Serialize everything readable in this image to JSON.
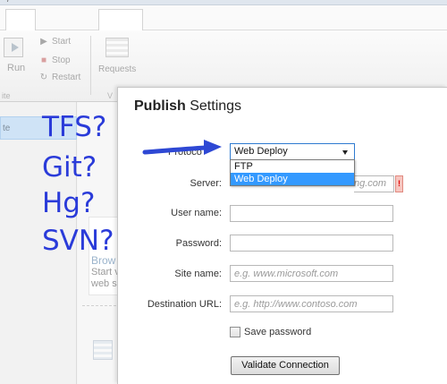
{
  "app": {
    "title_fragment": "/",
    "ribbon": {
      "run_label": "Run",
      "start_label": "Start",
      "stop_label": "Stop",
      "restart_label": "Restart",
      "requests_label": "Requests",
      "group_fragment_left": "ite",
      "group_fragment_right": "V"
    },
    "left_pane": {
      "selected_fragment": "te"
    },
    "middle": {
      "browse_fragment": "Brow",
      "desc_line1": "Start v",
      "desc_line2": "web s"
    }
  },
  "overlay": {
    "labels": [
      "TFS?",
      "Git?",
      "Hg?",
      "SVN?"
    ],
    "arrow_color": "#2e48d4",
    "text_color": "#2a3bd9"
  },
  "dialog": {
    "title_bold": "Publish",
    "title_rest": " Settings",
    "protocol": {
      "label_fragment": "Protoco",
      "selected": "Web Deploy",
      "options": [
        "FTP",
        "Web Deploy"
      ],
      "highlighted_option": "Web Deploy"
    },
    "server": {
      "label": "Server:",
      "placeholder_fragment": "ng.com"
    },
    "username": {
      "label": "User name:",
      "value": ""
    },
    "password": {
      "label": "Password:",
      "value": ""
    },
    "site_name": {
      "label": "Site name:",
      "placeholder": "e.g. www.microsoft.com"
    },
    "destination_url": {
      "label": "Destination URL:",
      "placeholder": "e.g. http://www.contoso.com"
    },
    "save_password": {
      "label": "Save password",
      "checked": false
    },
    "validate_button": "Validate Connection",
    "accent_color": "#3399ff"
  }
}
